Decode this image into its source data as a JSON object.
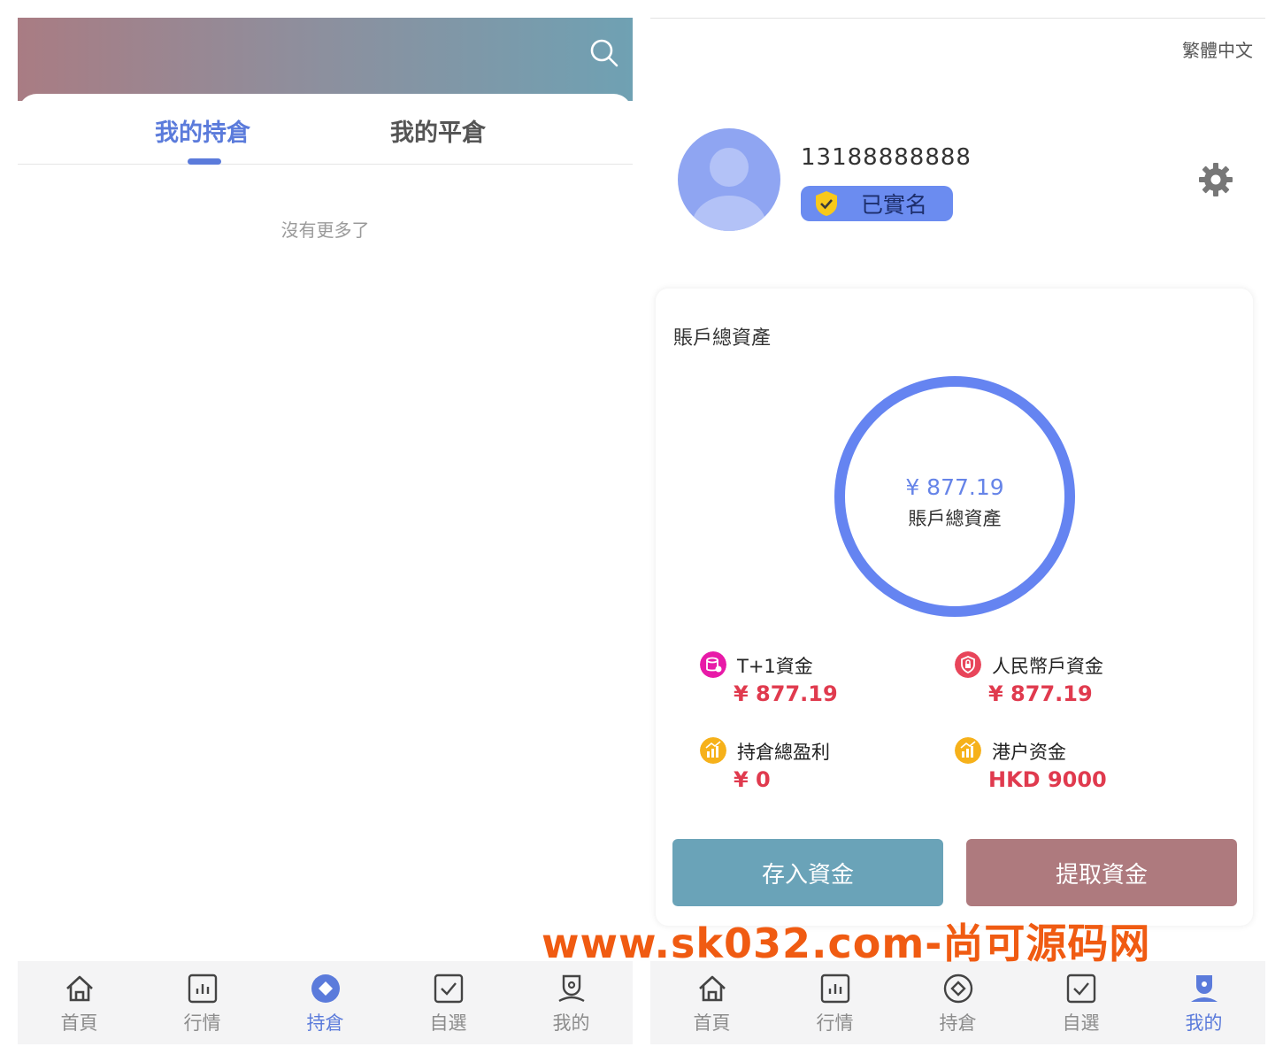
{
  "left_screen": {
    "tabs": [
      {
        "label": "我的持倉",
        "active": true
      },
      {
        "label": "我的平倉",
        "active": false
      }
    ],
    "empty_text": "沒有更多了",
    "header_gradient": [
      "#a97c83",
      "#6fa1b3"
    ]
  },
  "right_screen": {
    "language": "繁體中文",
    "user": {
      "phone": "13188888888",
      "verified_label": "已實名"
    },
    "assets": {
      "title": "賬戶總資產",
      "total_amount": "¥ 877.19",
      "total_label": "賬戶總資產",
      "stats": [
        {
          "label": "T+1資金",
          "value": "¥ 877.19",
          "icon": "database-icon",
          "color": "#e81aa8"
        },
        {
          "label": "人民幣戶資金",
          "value": "¥ 877.19",
          "icon": "shield-lock-icon",
          "color": "#e8455a"
        },
        {
          "label": "持倉總盈利",
          "value": "¥ 0",
          "icon": "chart-up-icon",
          "color": "#f6b11a"
        },
        {
          "label": "港户资金",
          "value": "HKD 9000",
          "icon": "chart-up-icon",
          "color": "#f6b11a"
        }
      ]
    },
    "buttons": {
      "deposit": "存入資金",
      "withdraw": "提取資金"
    }
  },
  "nav": [
    {
      "label": "首頁",
      "icon": "home-icon"
    },
    {
      "label": "行情",
      "icon": "bar-chart-icon"
    },
    {
      "label": "持倉",
      "icon": "position-icon"
    },
    {
      "label": "自選",
      "icon": "checkbox-icon"
    },
    {
      "label": "我的",
      "icon": "user-icon"
    }
  ],
  "left_active_nav": "持倉",
  "right_active_nav": "我的",
  "colors": {
    "accent": "#5b7bdb",
    "value_red": "#e03a4e",
    "deposit": "#6aa3b8",
    "withdraw": "#ae7a7e"
  },
  "watermark": "www.sk032.com-尚可源码网"
}
